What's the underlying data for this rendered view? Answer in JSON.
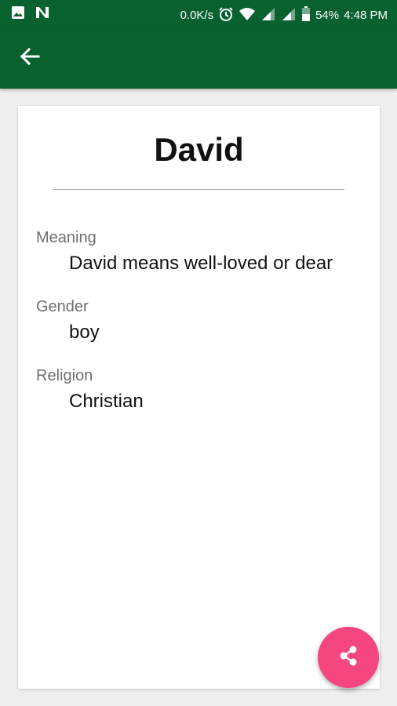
{
  "status_bar": {
    "network_speed": "0.0K/s",
    "battery": "54%",
    "time": "4:48 PM",
    "icons": [
      "image-icon",
      "n-notification-icon",
      "alarm-icon",
      "wifi-icon",
      "signal-icon",
      "signal-icon",
      "battery-icon"
    ]
  },
  "app_bar": {
    "back_icon": "arrow-left-icon",
    "color": "#0a6130"
  },
  "detail": {
    "name": "David",
    "fields": [
      {
        "label": "Meaning",
        "value": "David means well-loved or dear"
      },
      {
        "label": "Gender",
        "value": "boy"
      },
      {
        "label": "Religion",
        "value": "Christian"
      }
    ]
  },
  "fab": {
    "icon": "share-icon",
    "color": "#f5467f"
  }
}
